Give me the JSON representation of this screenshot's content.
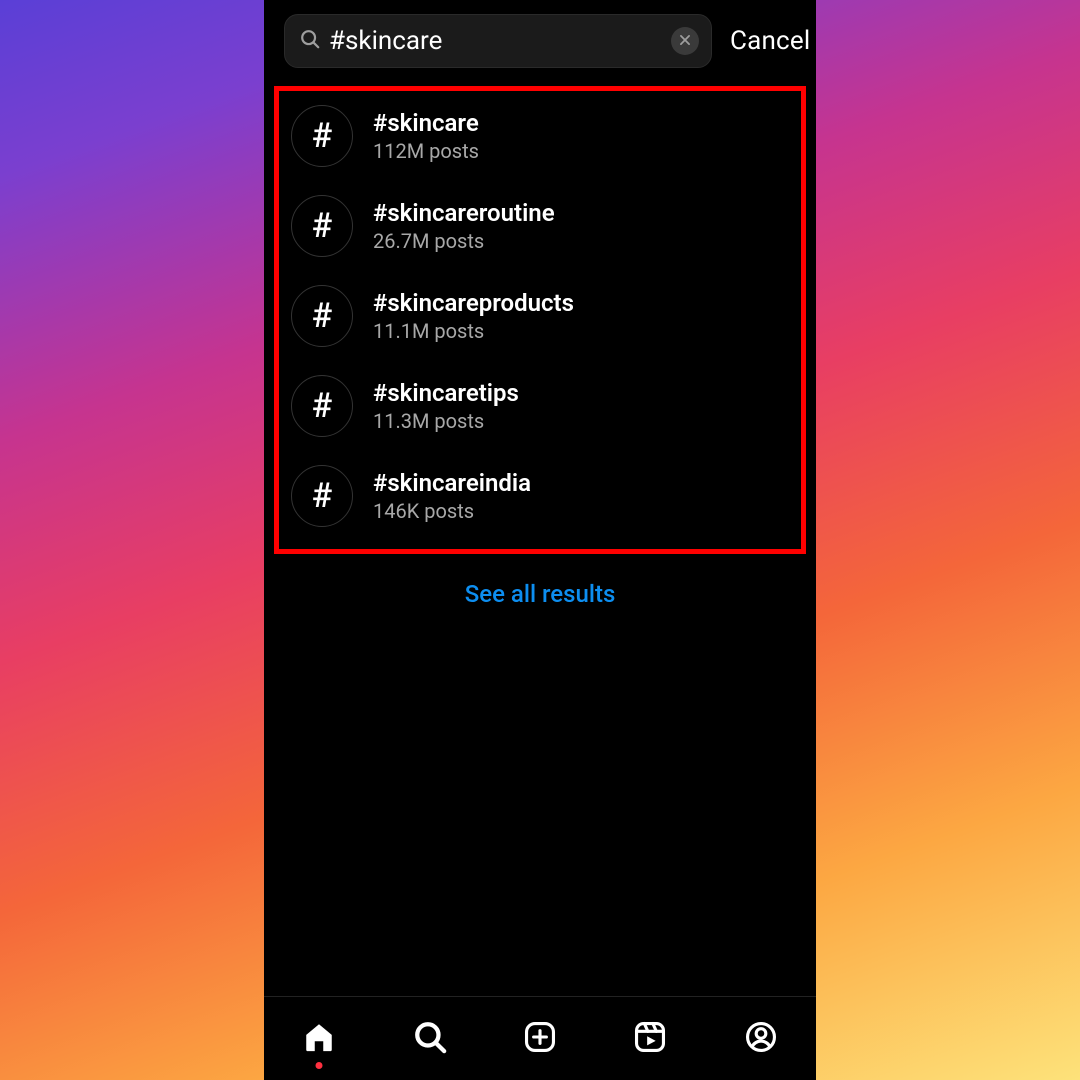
{
  "search": {
    "value": "#skincare"
  },
  "cancel_label": "Cancel",
  "results": [
    {
      "title": "#skincare",
      "sub": "112M posts"
    },
    {
      "title": "#skincareroutine",
      "sub": "26.7M posts"
    },
    {
      "title": "#skincareproducts",
      "sub": "11.1M posts"
    },
    {
      "title": "#skincaretips",
      "sub": "11.3M posts"
    },
    {
      "title": "#skincareindia",
      "sub": "146K posts"
    }
  ],
  "see_all_label": "See all results",
  "hash_glyph": "#"
}
